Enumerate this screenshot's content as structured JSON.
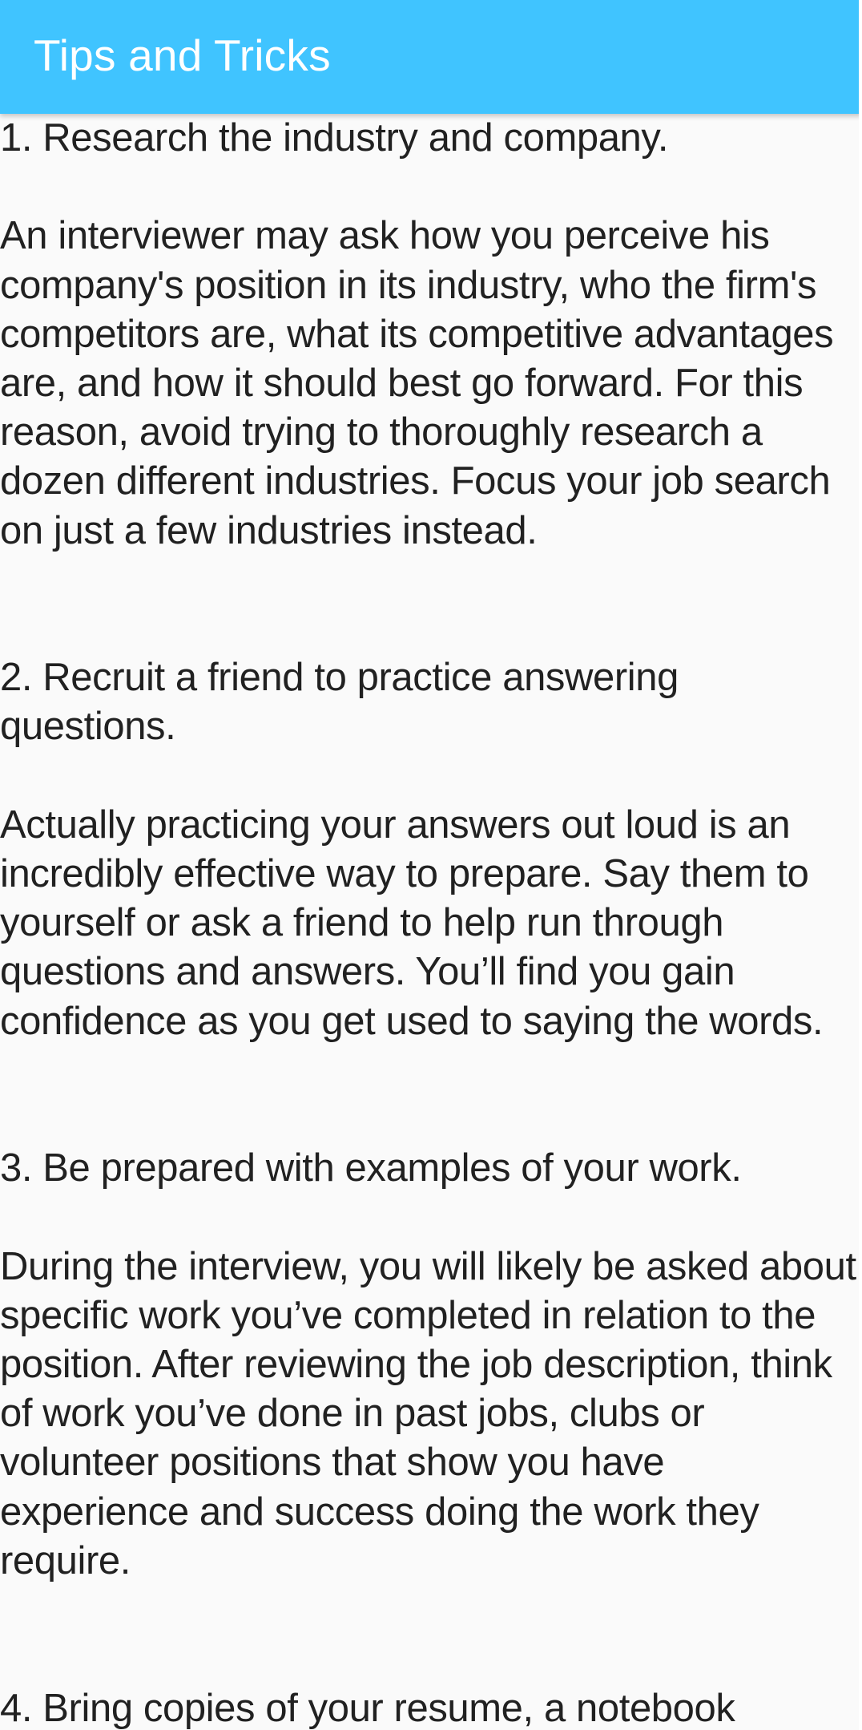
{
  "appbar": {
    "title": "Tips and Tricks"
  },
  "content": {
    "text": "1. Research the industry and company.\n\nAn interviewer may ask how you perceive his company's position in its industry, who the firm's competitors are, what its competitive advantages are, and how it should best go forward. For this reason, avoid trying to thoroughly research a dozen different industries. Focus your job search on just a few industries instead.\n\n\n2. Recruit a friend to practice answering questions.\n\nActually practicing your answers out loud is an incredibly effective way to prepare. Say them to yourself or ask a friend to help run through questions and answers. You’ll find you gain confidence as you get used to saying the words.\n\n\n3. Be prepared with examples of your work.\n\nDuring the interview, you will likely be asked about specific work you’ve completed in relation to the position. After reviewing the job description, think of work you’ve done in past jobs, clubs or volunteer positions that show you have experience and success doing the work they require.\n\n\n4. Bring copies of your resume, a notebook"
  },
  "colors": {
    "appbar_background": "#40c4ff",
    "appbar_text": "#ffffff",
    "page_background": "#fafafa",
    "body_text": "#212121"
  }
}
